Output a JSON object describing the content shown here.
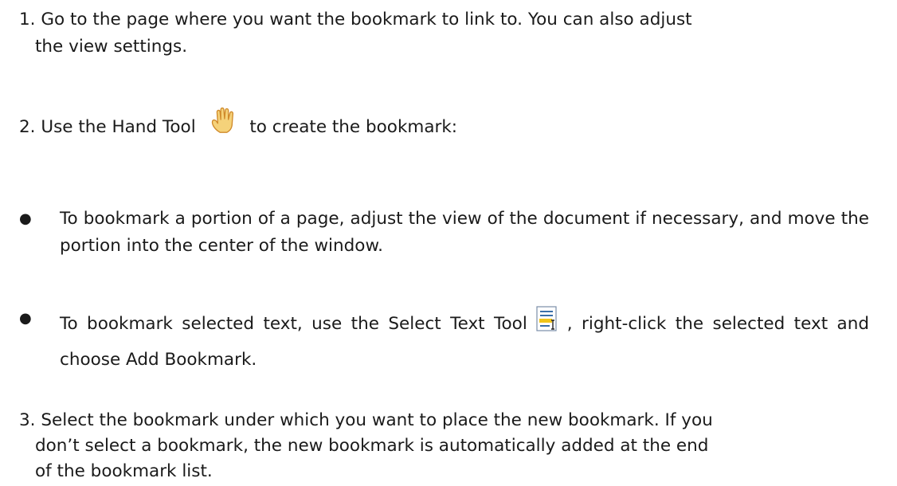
{
  "step1": {
    "line1": "1. Go to the page where you want the bookmark to link to. You can also adjust",
    "line2": "the view settings."
  },
  "step2": {
    "before_icon": "2. Use the Hand Tool",
    "after_icon": "to create the bookmark:",
    "icon": "hand-icon"
  },
  "bullets": {
    "symbol": "●",
    "item1": "To bookmark a portion of a page, adjust the view of the document if necessary, and move the portion into the center of the window.",
    "item2_before_icon": "To bookmark selected text, use the Select Text Tool",
    "item2_after_icon": ", right-click the selected text and choose Add Bookmark.",
    "item2_icon": "select-text-icon"
  },
  "step3": {
    "line1": "3. Select the bookmark under which you want to place the new bookmark. If you",
    "line2": "don’t select a bookmark, the new bookmark is automatically added at the end",
    "line3": "of the bookmark list."
  },
  "colors": {
    "text": "#1a1a1a",
    "hand_fill": "#f5d27a",
    "hand_outline": "#d08a2a",
    "doc_icon_lines": "#3a6ea8",
    "doc_icon_highlight": "#f0c419"
  }
}
